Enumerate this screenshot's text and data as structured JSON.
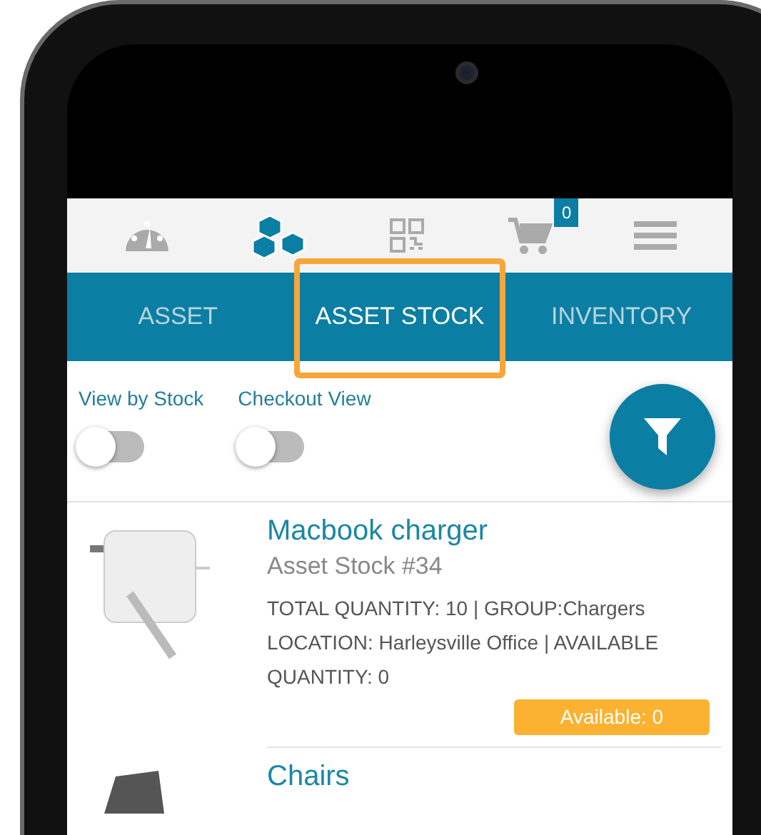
{
  "nav_icons": [
    {
      "kind": "gauge",
      "selected": false
    },
    {
      "kind": "cubes",
      "selected": true
    },
    {
      "kind": "qr",
      "selected": false
    },
    {
      "kind": "cart",
      "selected": false,
      "badge": "0"
    },
    {
      "kind": "menu",
      "selected": false
    }
  ],
  "tabs": [
    {
      "label": "ASSET",
      "selected": false,
      "highlighted": false
    },
    {
      "label": "ASSET STOCK",
      "selected": true,
      "highlighted": true
    },
    {
      "label": "INVENTORY",
      "selected": false,
      "highlighted": false
    }
  ],
  "toggles": [
    {
      "label": "View by Stock",
      "on": false
    },
    {
      "label": "Checkout View",
      "on": false
    }
  ],
  "items": [
    {
      "kind": "charger",
      "title": "Macbook charger",
      "subtitle": "Asset Stock #34",
      "details": "TOTAL QUANTITY: 10 | GROUP:Chargers LOCATION: Harleysville Office | AVAILABLE QUANTITY: 0",
      "badge": "Available: 0"
    },
    {
      "kind": "chair",
      "title": "Chairs"
    }
  ]
}
